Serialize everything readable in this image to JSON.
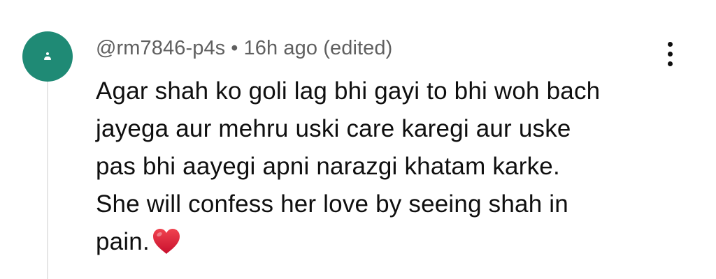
{
  "comment": {
    "author": "@rm7846-p4s",
    "separator": "•",
    "time": "16h ago",
    "edited_label": "(edited)",
    "lines": [
      "Agar shah ko goli lag bhi gayi to bhi woh bach",
      "jayega aur mehru uski care karegi aur uske",
      "pas bhi aayegi apni narazgi khatam karke.",
      "She will confess her love by seeing shah in",
      "pain."
    ],
    "trailing_emoji": "heart-emoji"
  },
  "avatar": {
    "color": "#1f8a75",
    "icon": "person-icon"
  },
  "more_button": {
    "icon": "more-vertical-icon"
  },
  "colors": {
    "meta_text": "#606060",
    "body_text": "#0f0f0f",
    "thread_line": "#e6e6e6",
    "heart": "#e0233b"
  }
}
